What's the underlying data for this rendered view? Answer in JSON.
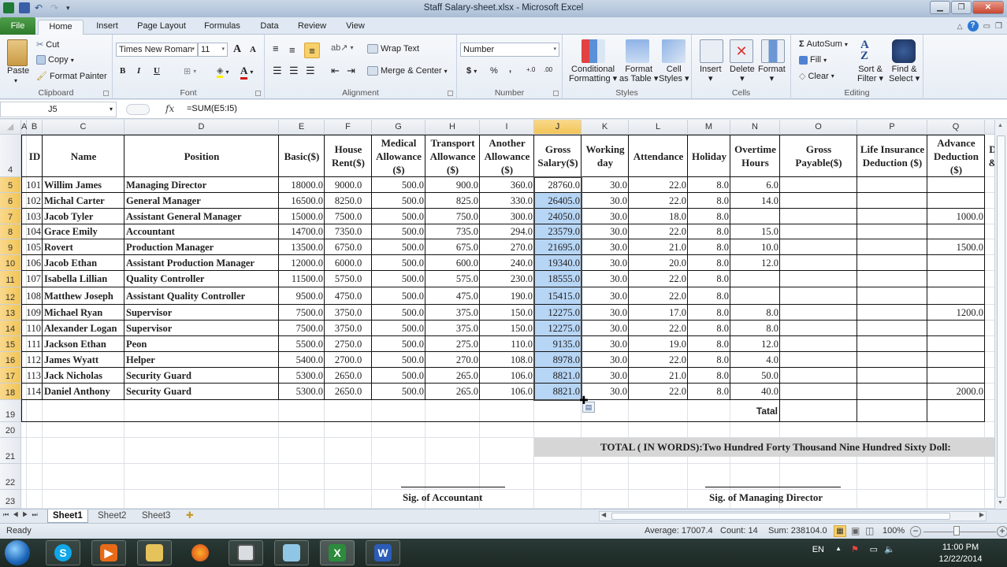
{
  "window": {
    "title": "Staff  Salary-sheet.xlsx - Microsoft Excel",
    "minimize_icon": "minimize-icon",
    "restore_icon": "restore-icon",
    "close_icon": "close-icon"
  },
  "ribbon_tabs": [
    "File",
    "Home",
    "Insert",
    "Page Layout",
    "Formulas",
    "Data",
    "Review",
    "View"
  ],
  "ribbon": {
    "clipboard": {
      "paste": "Paste",
      "cut": "Cut",
      "copy": "Copy",
      "format_painter": "Format Painter",
      "label": "Clipboard"
    },
    "font": {
      "family": "Times New Roman",
      "size": "11",
      "bold": "B",
      "italic": "I",
      "underline": "U",
      "grow": "A",
      "shrink": "A",
      "label": "Font"
    },
    "alignment": {
      "wrap": "Wrap Text",
      "merge": "Merge & Center",
      "label": "Alignment"
    },
    "number": {
      "format": "Number",
      "currency": "$",
      "percent": "%",
      "comma": ",",
      "inc": "+.0",
      "dec": ".00",
      "label": "Number"
    },
    "styles": {
      "conditional": "Conditional",
      "conditional2": "Formatting",
      "format_table": "Format",
      "format_table2": "as Table",
      "cell_styles": "Cell",
      "cell_styles2": "Styles",
      "label": "Styles"
    },
    "cells": {
      "insert": "Insert",
      "delete": "Delete",
      "format": "Format",
      "label": "Cells"
    },
    "editing": {
      "autosum": "AutoSum",
      "fill": "Fill",
      "clear": "Clear",
      "sort": "Sort &",
      "sort2": "Filter",
      "find": "Find &",
      "find2": "Select",
      "label": "Editing"
    }
  },
  "formula_bar": {
    "name_box": "J5",
    "fx": "fx",
    "formula": "=SUM(E5:I5)"
  },
  "columns": [
    "A",
    "B",
    "C",
    "D",
    "E",
    "F",
    "G",
    "H",
    "I",
    "J",
    "K",
    "L",
    "M",
    "N",
    "O",
    "P",
    "Q",
    ""
  ],
  "selected_column": "J",
  "header_row": {
    "row_num": "4",
    "cells": [
      "ID",
      "Name",
      "Position",
      "Basic($)",
      "House Rent($)",
      "Medical Allowance ($)",
      "Transport Allowance ($)",
      "Another Allowance ($)",
      "Gross Salary($)",
      "Working day",
      "Attendance",
      "Holiday",
      "Overtime Hours",
      "Gross Payable($)",
      "Life Insurance Deduction ($)",
      "Advance Deduction ($)",
      "D &"
    ]
  },
  "rows": [
    {
      "r": "5",
      "id": "101",
      "name": "Willim James",
      "pos": "Managing Director",
      "basic": "18000.0",
      "house": "9000.0",
      "med": "500.0",
      "trans": "900.0",
      "other": "360.0",
      "gross": "28760.0",
      "wd": "30.0",
      "att": "22.0",
      "hol": "8.0",
      "ot": "6.0",
      "gp": "",
      "life": "",
      "adv": ""
    },
    {
      "r": "6",
      "id": "102",
      "name": "Michal Carter",
      "pos": "General Manager",
      "basic": "16500.0",
      "house": "8250.0",
      "med": "500.0",
      "trans": "825.0",
      "other": "330.0",
      "gross": "26405.0",
      "wd": "30.0",
      "att": "22.0",
      "hol": "8.0",
      "ot": "14.0",
      "gp": "",
      "life": "",
      "adv": ""
    },
    {
      "r": "7",
      "id": "103",
      "name": "Jacob Tyler",
      "pos": "Assistant General Manager",
      "basic": "15000.0",
      "house": "7500.0",
      "med": "500.0",
      "trans": "750.0",
      "other": "300.0",
      "gross": "24050.0",
      "wd": "30.0",
      "att": "18.0",
      "hol": "8.0",
      "ot": "",
      "gp": "",
      "life": "",
      "adv": "1000.0"
    },
    {
      "r": "8",
      "id": "104",
      "name": "Grace Emily",
      "pos": "Accountant",
      "basic": "14700.0",
      "house": "7350.0",
      "med": "500.0",
      "trans": "735.0",
      "other": "294.0",
      "gross": "23579.0",
      "wd": "30.0",
      "att": "22.0",
      "hol": "8.0",
      "ot": "15.0",
      "gp": "",
      "life": "",
      "adv": ""
    },
    {
      "r": "9",
      "id": "105",
      "name": "Rovert",
      "pos": "Production Manager",
      "basic": "13500.0",
      "house": "6750.0",
      "med": "500.0",
      "trans": "675.0",
      "other": "270.0",
      "gross": "21695.0",
      "wd": "30.0",
      "att": "21.0",
      "hol": "8.0",
      "ot": "10.0",
      "gp": "",
      "life": "",
      "adv": "1500.0"
    },
    {
      "r": "10",
      "id": "106",
      "name": "Jacob Ethan",
      "pos": "Assistant Production Manager",
      "basic": "12000.0",
      "house": "6000.0",
      "med": "500.0",
      "trans": "600.0",
      "other": "240.0",
      "gross": "19340.0",
      "wd": "30.0",
      "att": "20.0",
      "hol": "8.0",
      "ot": "12.0",
      "gp": "",
      "life": "",
      "adv": ""
    },
    {
      "r": "11",
      "id": "107",
      "name": "Isabella Lillian",
      "pos": "Quality Controller",
      "basic": "11500.0",
      "house": "5750.0",
      "med": "500.0",
      "trans": "575.0",
      "other": "230.0",
      "gross": "18555.0",
      "wd": "30.0",
      "att": "22.0",
      "hol": "8.0",
      "ot": "",
      "gp": "",
      "life": "",
      "adv": ""
    },
    {
      "r": "12",
      "id": "108",
      "name": "Matthew Joseph",
      "pos": "Assistant Quality Controller",
      "basic": "9500.0",
      "house": "4750.0",
      "med": "500.0",
      "trans": "475.0",
      "other": "190.0",
      "gross": "15415.0",
      "wd": "30.0",
      "att": "22.0",
      "hol": "8.0",
      "ot": "",
      "gp": "",
      "life": "",
      "adv": ""
    },
    {
      "r": "13",
      "id": "109",
      "name": "Michael Ryan",
      "pos": "Supervisor",
      "basic": "7500.0",
      "house": "3750.0",
      "med": "500.0",
      "trans": "375.0",
      "other": "150.0",
      "gross": "12275.0",
      "wd": "30.0",
      "att": "17.0",
      "hol": "8.0",
      "ot": "8.0",
      "gp": "",
      "life": "",
      "adv": "1200.0"
    },
    {
      "r": "14",
      "id": "110",
      "name": "Alexander Logan",
      "pos": "Supervisor",
      "basic": "7500.0",
      "house": "3750.0",
      "med": "500.0",
      "trans": "375.0",
      "other": "150.0",
      "gross": "12275.0",
      "wd": "30.0",
      "att": "22.0",
      "hol": "8.0",
      "ot": "8.0",
      "gp": "",
      "life": "",
      "adv": ""
    },
    {
      "r": "15",
      "id": "111",
      "name": "Jackson Ethan",
      "pos": "Peon",
      "basic": "5500.0",
      "house": "2750.0",
      "med": "500.0",
      "trans": "275.0",
      "other": "110.0",
      "gross": "9135.0",
      "wd": "30.0",
      "att": "19.0",
      "hol": "8.0",
      "ot": "12.0",
      "gp": "",
      "life": "",
      "adv": ""
    },
    {
      "r": "16",
      "id": "112",
      "name": "James Wyatt",
      "pos": "Helper",
      "basic": "5400.0",
      "house": "2700.0",
      "med": "500.0",
      "trans": "270.0",
      "other": "108.0",
      "gross": "8978.0",
      "wd": "30.0",
      "att": "22.0",
      "hol": "8.0",
      "ot": "4.0",
      "gp": "",
      "life": "",
      "adv": ""
    },
    {
      "r": "17",
      "id": "113",
      "name": "Jack Nicholas",
      "pos": "Security Guard",
      "basic": "5300.0",
      "house": "2650.0",
      "med": "500.0",
      "trans": "265.0",
      "other": "106.0",
      "gross": "8821.0",
      "wd": "30.0",
      "att": "21.0",
      "hol": "8.0",
      "ot": "50.0",
      "gp": "",
      "life": "",
      "adv": ""
    },
    {
      "r": "18",
      "id": "114",
      "name": "Daniel Anthony",
      "pos": "Security Guard",
      "basic": "5300.0",
      "house": "2650.0",
      "med": "500.0",
      "trans": "265.0",
      "other": "106.0",
      "gross": "8821.0",
      "wd": "30.0",
      "att": "22.0",
      "hol": "8.0",
      "ot": "40.0",
      "gp": "",
      "life": "",
      "adv": "2000.0"
    }
  ],
  "extra_rows": [
    "19",
    "20",
    "21",
    "22",
    "23"
  ],
  "total_label": "Tatal",
  "total_in_words": "TOTAL ( IN WORDS):Two Hundred Forty Thousand Nine Hundred Sixty  Doll:",
  "sig_accountant": "Sig. of Accountant",
  "sig_md": "Sig. of Managing Director",
  "sheets": [
    "Sheet1",
    "Sheet2",
    "Sheet3"
  ],
  "active_sheet": "Sheet1",
  "status": {
    "mode": "Ready",
    "average": "Average: 17007.4",
    "count": "Count: 14",
    "sum": "Sum: 238104.0",
    "zoom": "100%"
  },
  "taskbar": {
    "apps": [
      "skype-icon",
      "media-player-icon",
      "file-explorer-icon",
      "firefox-icon",
      "video-icon",
      "notepad-icon",
      "excel-icon",
      "word-icon"
    ],
    "lang": "EN",
    "time": "11:00 PM",
    "date": "12/22/2014"
  }
}
